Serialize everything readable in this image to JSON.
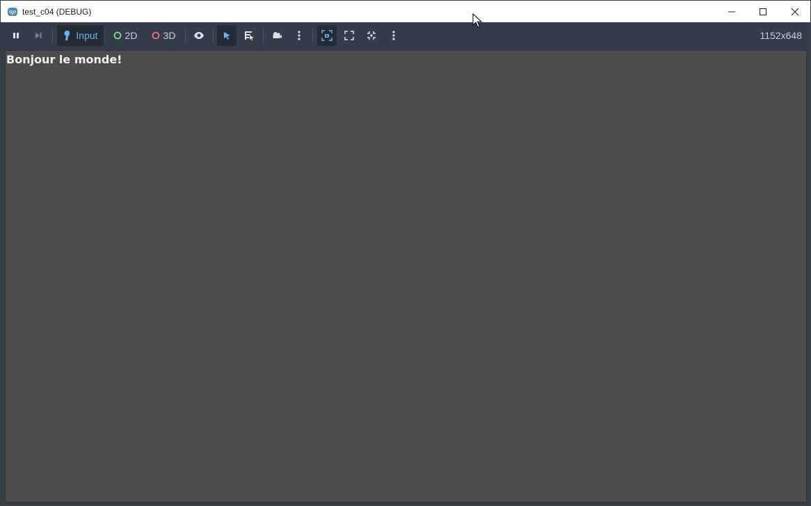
{
  "window": {
    "title": "test_c04 (DEBUG)",
    "controls": [
      "minimize",
      "maximize",
      "close"
    ]
  },
  "toolbar": {
    "pause_icon": "pause-icon",
    "next_frame_icon": "next-frame-icon",
    "modes": [
      {
        "label": "Input",
        "icon": "input-icon",
        "active": true,
        "color": "#6cb4f5"
      },
      {
        "label": "2D",
        "icon": "circle-2d-icon",
        "active": false,
        "color": "#8eef97"
      },
      {
        "label": "3D",
        "icon": "circle-3d-icon",
        "active": false,
        "color": "#fc7f7f"
      }
    ],
    "tools": [
      {
        "name": "visibility-icon",
        "active": false
      },
      {
        "name": "select-arrow-icon",
        "active": true
      },
      {
        "name": "list-select-icon",
        "active": false
      },
      {
        "name": "camera-icon",
        "active": false
      },
      {
        "name": "more-vertical-icon",
        "active": false
      },
      {
        "name": "camera-override-icon",
        "active": true
      },
      {
        "name": "fit-view-icon",
        "active": false
      },
      {
        "name": "reset-view-icon",
        "active": false
      },
      {
        "name": "more-vertical-icon",
        "active": false
      }
    ],
    "resolution": "1152x648"
  },
  "game": {
    "text": "Bonjour le monde!",
    "background": "#4d4d4d"
  },
  "colors": {
    "accent": "#6cb4f5",
    "toolbar_bg": "#363d4a"
  }
}
